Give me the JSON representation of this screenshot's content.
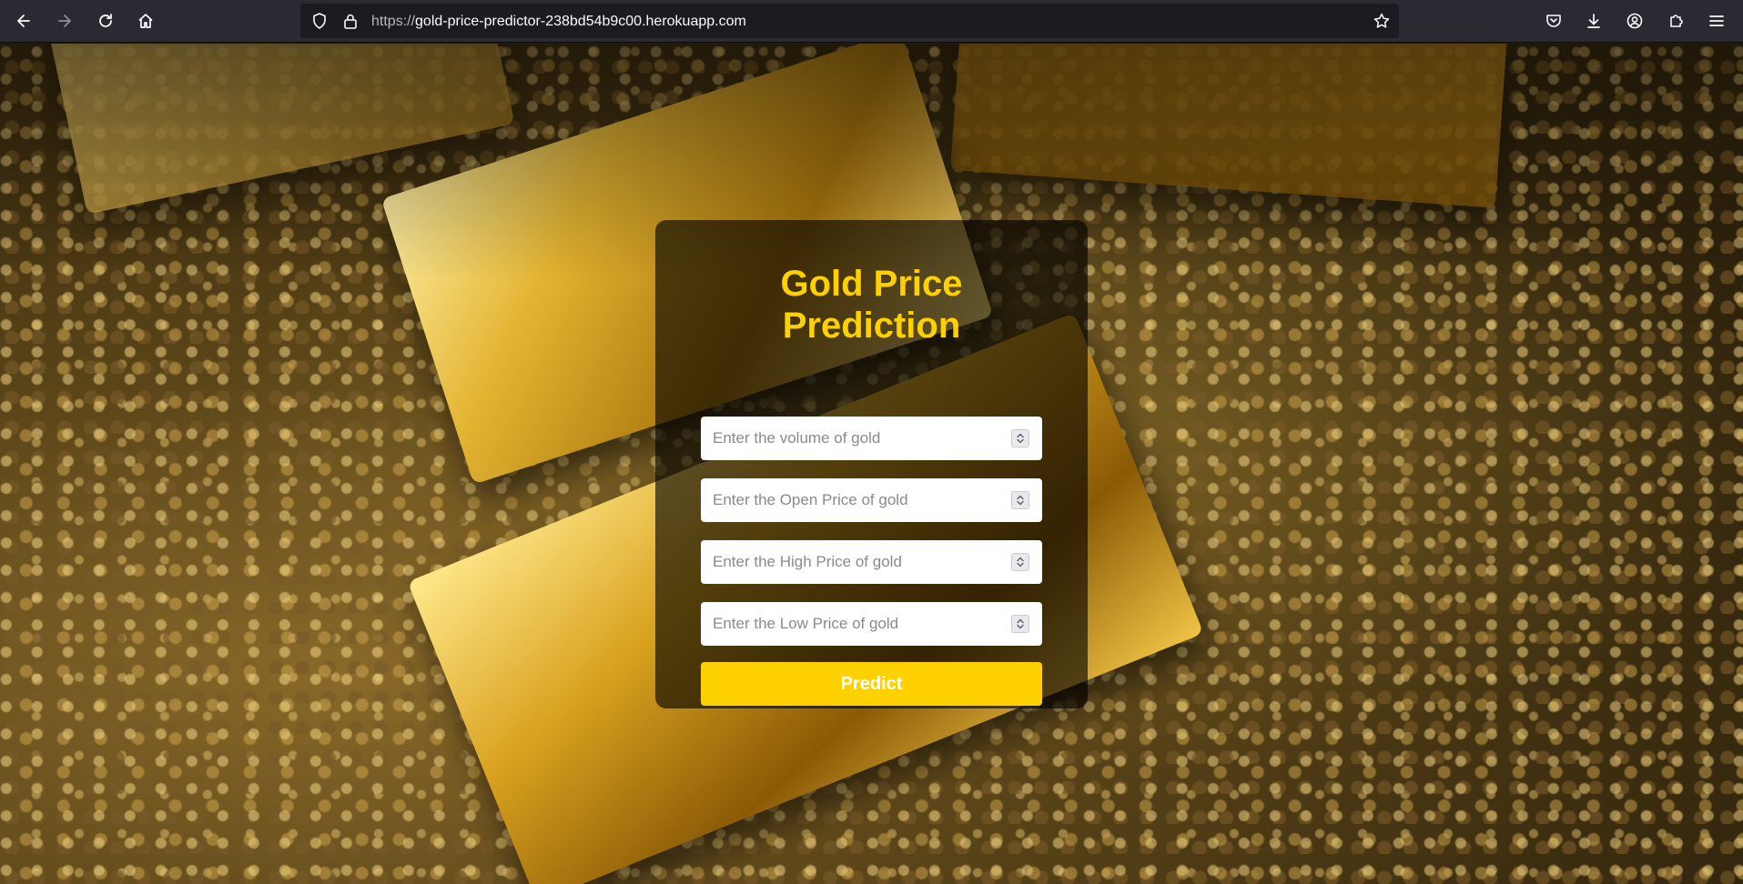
{
  "browser": {
    "url_prefix": "https://",
    "url_host": "gold-price-predictor-238bd54b9c00.herokuapp.com",
    "icons": [
      "back-icon",
      "forward-icon",
      "reload-icon",
      "home-icon",
      "shield-icon",
      "lock-icon",
      "bookmark-star-icon",
      "pocket-icon",
      "downloads-icon",
      "account-icon",
      "extensions-icon",
      "menu-icon"
    ]
  },
  "page": {
    "title_line1": "Gold Price",
    "title_line2": "Prediction",
    "fields": [
      {
        "placeholder": "Enter the volume of gold",
        "value": ""
      },
      {
        "placeholder": "Enter the Open Price of gold",
        "value": ""
      },
      {
        "placeholder": "Enter the High Price of gold",
        "value": ""
      },
      {
        "placeholder": "Enter the Low Price of gold",
        "value": ""
      }
    ],
    "predict_label": "Predict"
  },
  "colors": {
    "accent": "#ffd100",
    "card_background": "rgba(0,0,0,0.62)",
    "toolbar": "#2b2a33"
  }
}
